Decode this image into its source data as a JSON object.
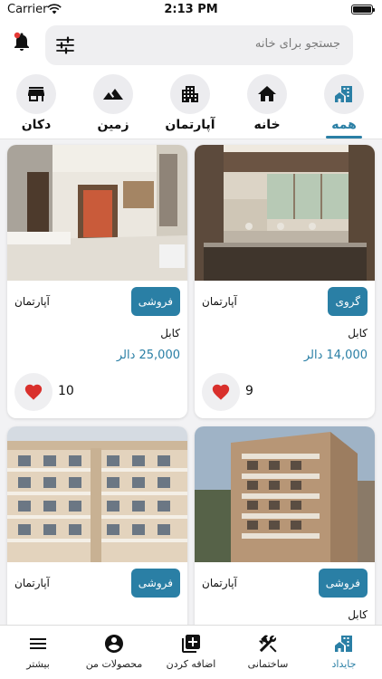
{
  "status_bar": {
    "carrier": "Carrier",
    "time": "2:13 PM"
  },
  "search": {
    "placeholder": "جستجو برای خانه"
  },
  "categories": [
    {
      "label": "همه",
      "icon": "building-house-icon",
      "active": true
    },
    {
      "label": "خانه",
      "icon": "house-icon"
    },
    {
      "label": "آپارتمان",
      "icon": "apartment-icon"
    },
    {
      "label": "زمین",
      "icon": "mountain-icon"
    },
    {
      "label": "دکان",
      "icon": "store-icon"
    }
  ],
  "listings": [
    {
      "badge": "گروی",
      "type": "آپارتمان",
      "city": "کابل",
      "price": "14,000 دالر",
      "likes": "9"
    },
    {
      "badge": "فروشی",
      "type": "آپارتمان",
      "city": "کابل",
      "price": "25,000 دالر",
      "likes": "10"
    },
    {
      "badge": "فروشی",
      "type": "آپارتمان",
      "city": "کابل"
    },
    {
      "badge": "فروشی",
      "type": "آپارتمان"
    }
  ],
  "tabbar": {
    "items": [
      {
        "label": "جایداد",
        "icon": "property-icon",
        "active": true
      },
      {
        "label": "ساختمانی",
        "icon": "tools-icon"
      },
      {
        "label": "اضافه کردن",
        "icon": "add-box-icon"
      },
      {
        "label": "محصولات من",
        "icon": "account-icon"
      },
      {
        "label": "بیشتر",
        "icon": "menu-icon"
      }
    ]
  },
  "colors": {
    "accent": "#2a7fa5",
    "heart": "#d9302c",
    "bell_dot": "#e53935"
  }
}
